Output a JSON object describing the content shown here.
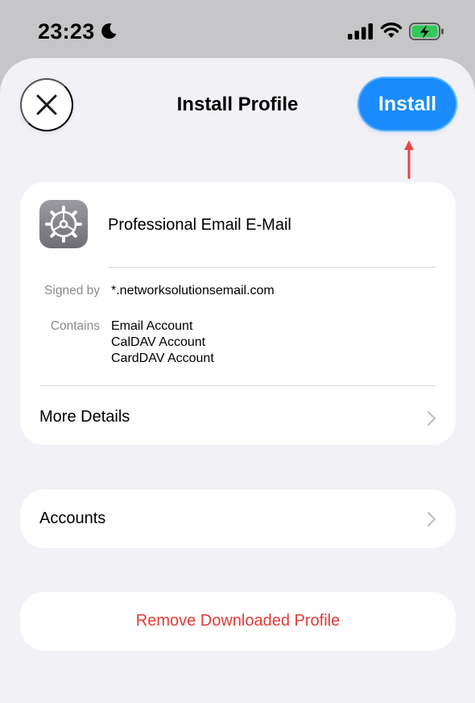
{
  "status_bar": {
    "time": "23:23"
  },
  "header": {
    "title": "Install Profile",
    "install_label": "Install"
  },
  "profile": {
    "name": "Professional Email E-Mail",
    "signed_by_label": "Signed by",
    "signed_by_value": "*.networksolutionsemail.com",
    "contains_label": "Contains",
    "contains_items": [
      "Email Account",
      "CalDAV Account",
      "CardDAV Account"
    ],
    "more_details_label": "More Details"
  },
  "accounts": {
    "label": "Accounts"
  },
  "remove": {
    "label": "Remove Downloaded Profile"
  },
  "colors": {
    "accent": "#1a8cff",
    "destructive": "#e53935",
    "annotation_arrow": "#e84545"
  }
}
